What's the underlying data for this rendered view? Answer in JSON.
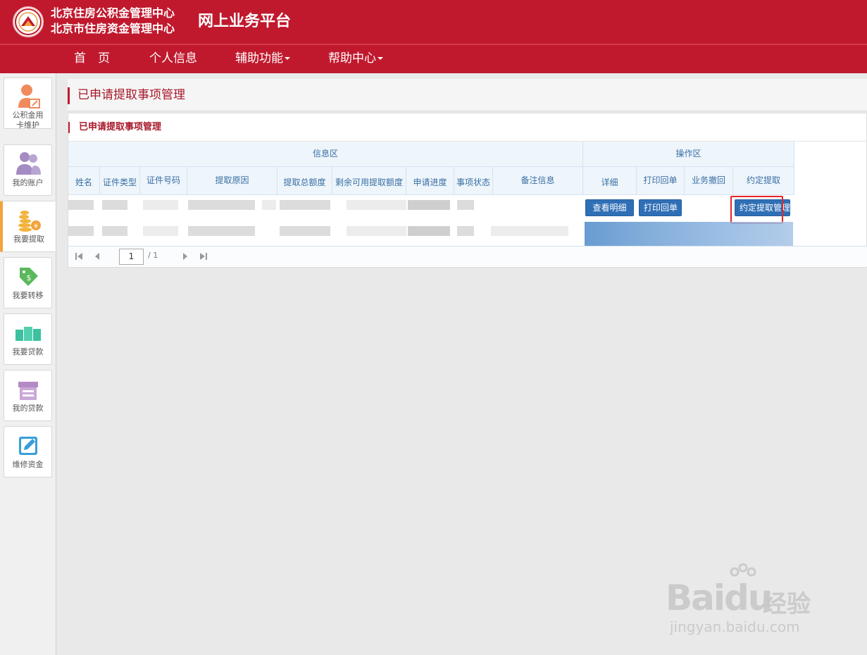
{
  "header": {
    "org_name_1": "北京住房公积金管理中心",
    "org_name_2": "北京市住房资金管理中心",
    "platform_title": "网上业务平台",
    "brand_color": "#c0192d"
  },
  "nav": {
    "items": [
      {
        "label": "首　页",
        "dropdown": false
      },
      {
        "label": "个人信息",
        "dropdown": false
      },
      {
        "label": "辅助功能",
        "dropdown": true
      },
      {
        "label": "帮助中心",
        "dropdown": true
      }
    ]
  },
  "sidebar": {
    "items": [
      {
        "label": "公积金用卡维护",
        "icon": "user-card-icon",
        "active": false
      },
      {
        "label": "我的账户",
        "icon": "users-icon",
        "active": false
      },
      {
        "label": "我要提取",
        "icon": "coins-icon",
        "active": true
      },
      {
        "label": "我要转移",
        "icon": "transfer-tag-icon",
        "active": false
      },
      {
        "label": "我要贷款",
        "icon": "money-icon",
        "active": false
      },
      {
        "label": "我的贷款",
        "icon": "shop-icon",
        "active": false
      },
      {
        "label": "维修资金",
        "icon": "edit-icon",
        "active": false
      }
    ]
  },
  "page": {
    "title": "已申请提取事项管理",
    "panel_title": "已申请提取事项管理"
  },
  "grid": {
    "group_headers": {
      "info": "信息区",
      "ops": "操作区"
    },
    "info_columns": [
      "姓名",
      "证件类型",
      "证件号码",
      "提取原因",
      "提取总额度",
      "剩余可用提取额度",
      "申请进度",
      "事项状态",
      "备注信息"
    ],
    "op_columns": [
      "详细",
      "打印回单",
      "业务撤回",
      "约定提取"
    ],
    "row1_buttons": {
      "detail": "查看明细",
      "print": "打印回单",
      "appointment": "约定提取管理"
    }
  },
  "pager": {
    "current_page": "1",
    "total": "/ 1"
  },
  "watermark": {
    "brand": "Bai",
    "brand_tail": "du",
    "brand_cn": "经验",
    "url": "jingyan.baidu.com"
  }
}
